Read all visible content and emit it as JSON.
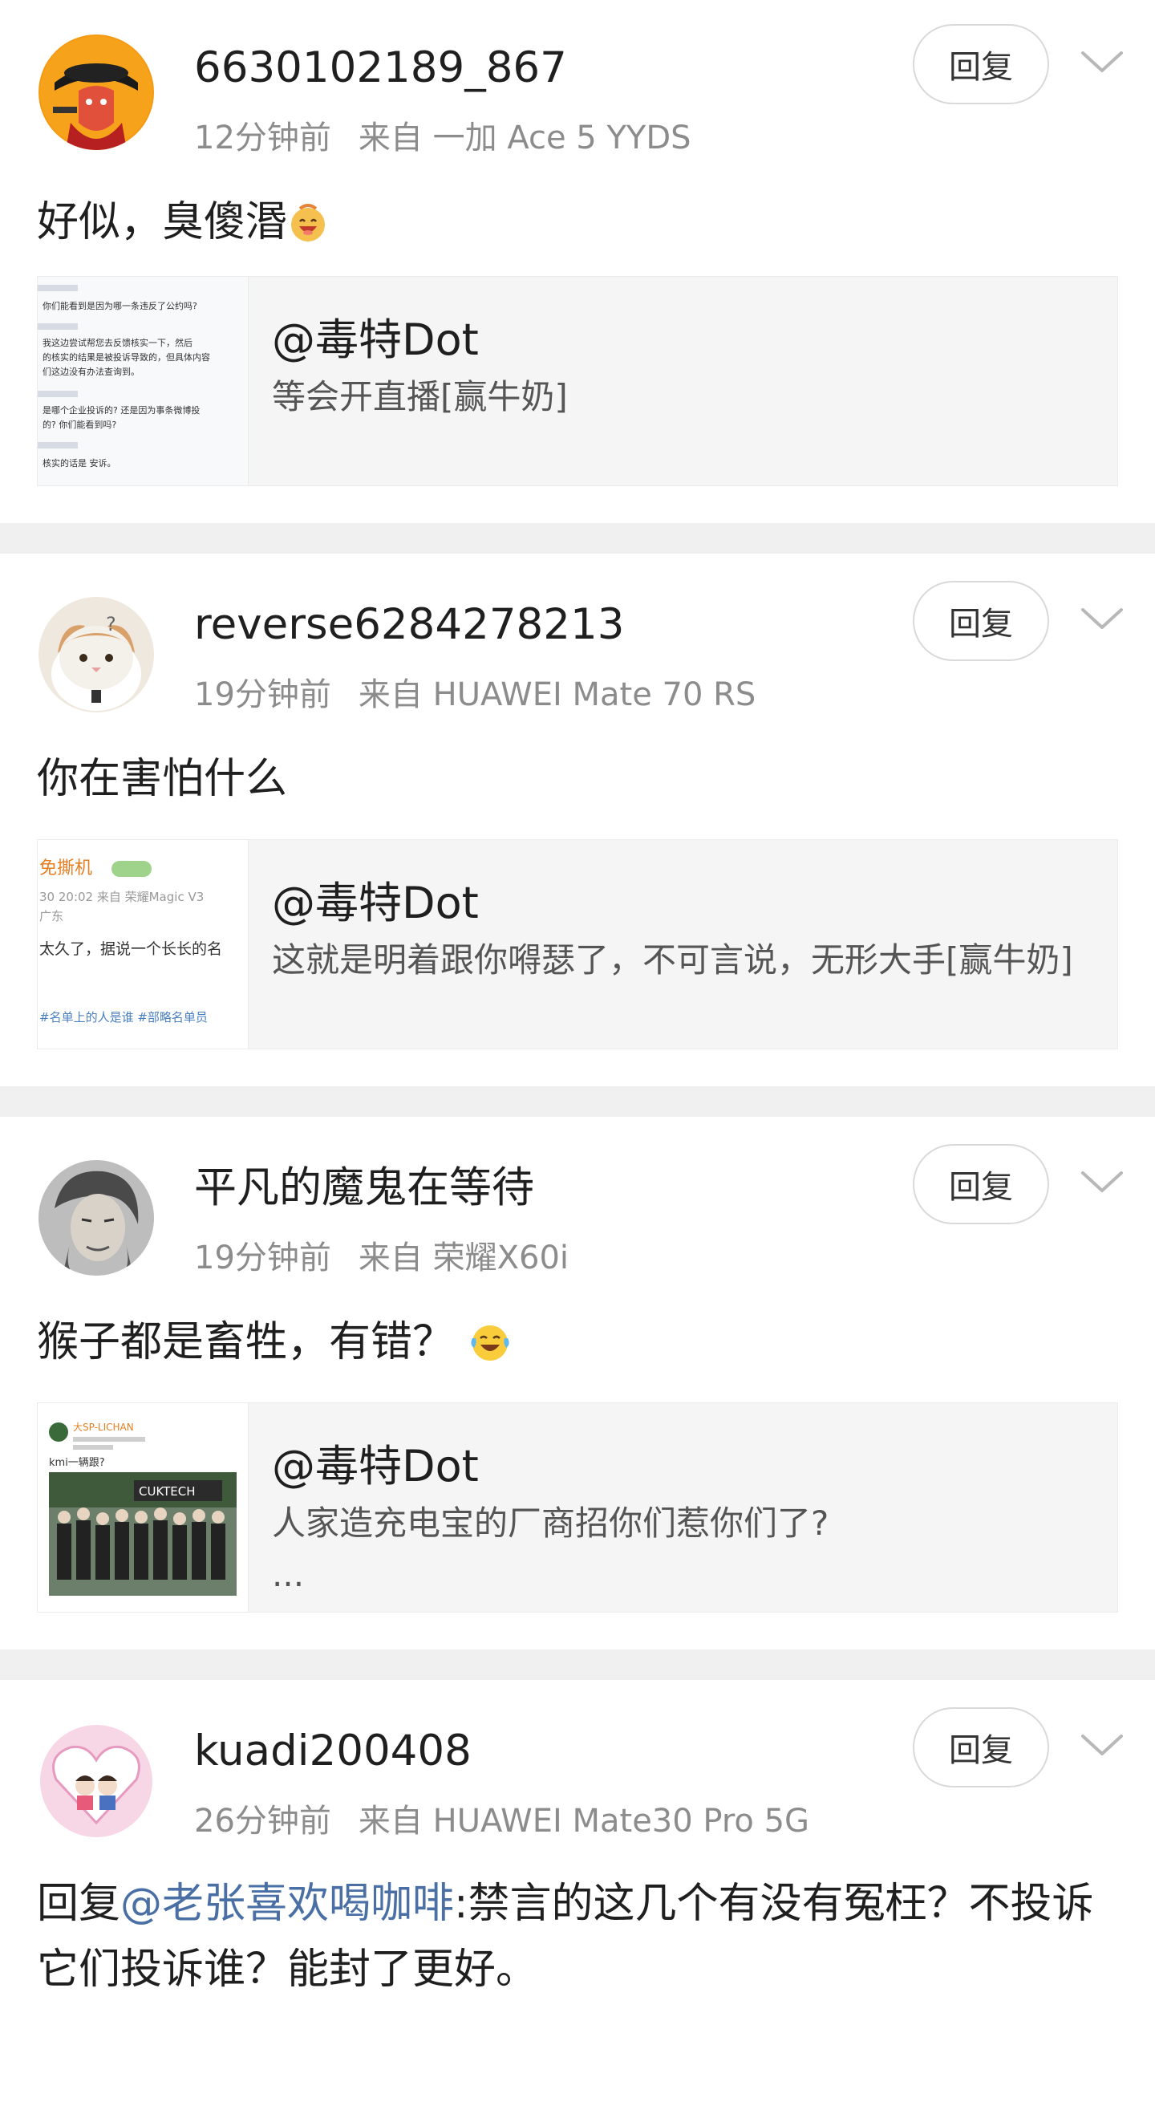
{
  "ui": {
    "reply_label": "回复"
  },
  "comments": [
    {
      "username": "6630102189_867",
      "time": "12分钟前",
      "source": "来自 一加 Ace 5 YYDS",
      "text": "好似，臭傻湣",
      "emoji": "laughing-face-emoji",
      "quote": {
        "author": "@毒特Dot",
        "text": "等会开直播[赢牛奶]",
        "thumb_lines": [
          "你们能看到是因为哪一条违反了公约吗?",
          "我这边尝试帮您去反馈核实一下，然后",
          "的核实的结果是被投诉导致的，但具体内容",
          "们这边没有办法查询到。",
          "是哪个企业投诉的? 还是因为事条微博投",
          "的? 你们能看到吗?",
          "核实的话是    安诉。"
        ]
      }
    },
    {
      "username": "reverse6284278213",
      "time": "19分钟前",
      "source": "来自 HUAWEI Mate 70 RS",
      "text": "你在害怕什么",
      "quote": {
        "author": "@毒特Dot",
        "text": "这就是明着跟你嘚瑟了，不可言说，无形大手[赢牛奶]",
        "thumb_lines": [
          "免撕机",
          "30 20:02  来自 荣耀Magic V3",
          "广东",
          "太久了，据说一个长长的名",
          "#名单上的人是谁   #部略名单员"
        ]
      }
    },
    {
      "username": "平凡的魔鬼在等待",
      "time": "19分钟前",
      "source": "来自 荣耀X60i",
      "text": "猴子都是畜牲，有错？",
      "emoji": "crying-laughing-emoji",
      "quote": {
        "author": "@毒特Dot",
        "text": "人家造充电宝的厂商招你们惹你们了?\n...",
        "thumb_lines": [
          "大SP-LICHAN",
          "kmi一辆跟?",
          "CUKTECH"
        ]
      }
    },
    {
      "username": "kuadi200408",
      "time": "26分钟前",
      "source": "来自 HUAWEI Mate30 Pro 5G",
      "text_prefix": "回复",
      "mention": "@老张喜欢喝咖啡",
      "text": ":禁言的这几个有没有冤枉？不投诉它们投诉谁？能封了更好。"
    }
  ]
}
